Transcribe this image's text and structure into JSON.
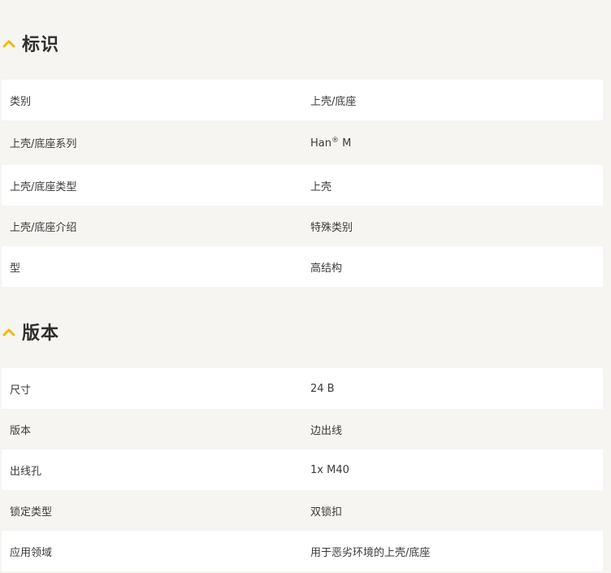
{
  "accent_color": "#f5b800",
  "sections": [
    {
      "title": "标识",
      "icon": "chevron-up-icon",
      "rows": [
        {
          "label": "类别",
          "value": "上壳/底座"
        },
        {
          "label": "上壳/底座系列",
          "value": "Han",
          "value_sup": "®",
          "value_suffix": " M"
        },
        {
          "label": "上壳/底座类型",
          "value": "上壳"
        },
        {
          "label": "上壳/底座介绍",
          "value": "特殊类别"
        },
        {
          "label": "型",
          "value": "高结构"
        }
      ]
    },
    {
      "title": "版本",
      "icon": "chevron-up-icon",
      "rows": [
        {
          "label": "尺寸",
          "value": "24 B"
        },
        {
          "label": "版本",
          "value": "边出线"
        },
        {
          "label": "出线孔",
          "value": "1x M40"
        },
        {
          "label": "锁定类型",
          "value": "双锁扣"
        },
        {
          "label": "应用领域",
          "value": "用于恶劣环境的上壳/底座"
        }
      ]
    }
  ]
}
